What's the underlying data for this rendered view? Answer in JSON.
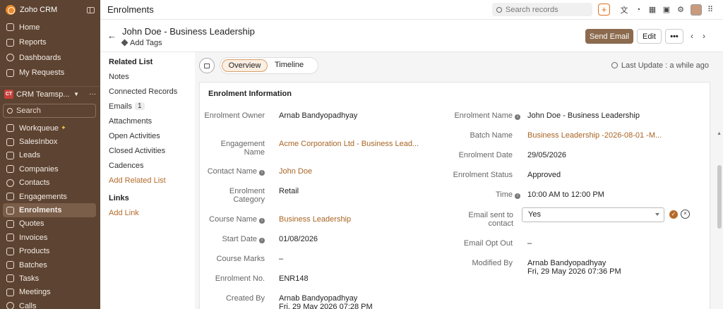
{
  "app": {
    "name": "Zoho CRM"
  },
  "sidebar": {
    "items": [
      {
        "label": "Home"
      },
      {
        "label": "Reports"
      },
      {
        "label": "Dashboards"
      },
      {
        "label": "My Requests"
      }
    ],
    "team": "CRM Teamsp...",
    "search_placeholder": "Search",
    "modules": [
      {
        "label": "Workqueue"
      },
      {
        "label": "SalesInbox"
      },
      {
        "label": "Leads"
      },
      {
        "label": "Companies"
      },
      {
        "label": "Contacts"
      },
      {
        "label": "Engagements"
      },
      {
        "label": "Enrolments"
      },
      {
        "label": "Quotes"
      },
      {
        "label": "Invoices"
      },
      {
        "label": "Products"
      },
      {
        "label": "Batches"
      },
      {
        "label": "Tasks"
      },
      {
        "label": "Meetings"
      },
      {
        "label": "Calls"
      }
    ]
  },
  "header": {
    "module": "Enrolments",
    "search_placeholder": "Search records"
  },
  "record": {
    "title": "John Doe - Business Leadership",
    "add_tags": "Add Tags",
    "send_email": "Send Email",
    "edit": "Edit",
    "more": "•••"
  },
  "related": {
    "heading": "Related List",
    "items": [
      {
        "label": "Notes"
      },
      {
        "label": "Connected Records"
      },
      {
        "label": "Emails",
        "count": "1"
      },
      {
        "label": "Attachments"
      },
      {
        "label": "Open Activities"
      },
      {
        "label": "Closed Activities"
      },
      {
        "label": "Cadences"
      },
      {
        "label": "Add Related List"
      }
    ],
    "links_heading": "Links",
    "add_link": "Add Link"
  },
  "tabs": {
    "overview": "Overview",
    "timeline": "Timeline",
    "last_update": "Last Update : a while ago"
  },
  "section": {
    "title": "Enrolment Information"
  },
  "fields": {
    "enrolment_owner": {
      "label": "Enrolment Owner",
      "value": "Arnab Bandyopadhyay"
    },
    "engagement_name": {
      "label": "Engagement Name",
      "value": "Acme Corporation Ltd - Business Lead..."
    },
    "contact_name": {
      "label": "Contact Name",
      "value": "John Doe"
    },
    "enrolment_category": {
      "label": "Enrolment Category",
      "value": "Retail"
    },
    "course_name": {
      "label": "Course Name",
      "value": "Business Leadership"
    },
    "start_date": {
      "label": "Start Date",
      "value": "01/08/2026"
    },
    "course_marks": {
      "label": "Course Marks",
      "value": "–"
    },
    "enrolment_no": {
      "label": "Enrolment No.",
      "value": "ENR148"
    },
    "created_by": {
      "label": "Created By",
      "value": "Arnab Bandyopadhyay",
      "sub": "Fri, 29 May 2026 07:28 PM"
    },
    "enrolment_name": {
      "label": "Enrolment Name",
      "value": "John Doe - Business Leadership"
    },
    "batch_name": {
      "label": "Batch Name",
      "value": "Business Leadership -2026-08-01 -M..."
    },
    "enrolment_date": {
      "label": "Enrolment Date",
      "value": "29/05/2026"
    },
    "enrolment_status": {
      "label": "Enrolment Status",
      "value": "Approved"
    },
    "time": {
      "label": "Time",
      "value": "10:00 AM to 12:00 PM"
    },
    "email_sent": {
      "label": "Email sent to contact",
      "value": "Yes"
    },
    "email_opt_out": {
      "label": "Email Opt Out",
      "value": "–"
    },
    "modified_by": {
      "label": "Modified By",
      "value": "Arnab Bandyopadhyay",
      "sub": "Fri, 29 May 2026 07:36 PM"
    }
  },
  "colors": {
    "sidebar": "#5d4331",
    "accent": "#8b6a4e",
    "link": "#a86424"
  }
}
